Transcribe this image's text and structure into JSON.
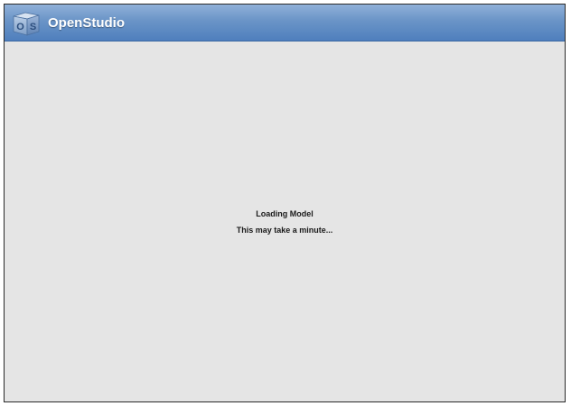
{
  "window": {
    "app_title": "OpenStudio",
    "logo_icon": "openstudio-logo-icon",
    "titlebar_color": "#5a86c1"
  },
  "content": {
    "status_title": "Loading Model",
    "status_message": "This may take a minute..."
  }
}
